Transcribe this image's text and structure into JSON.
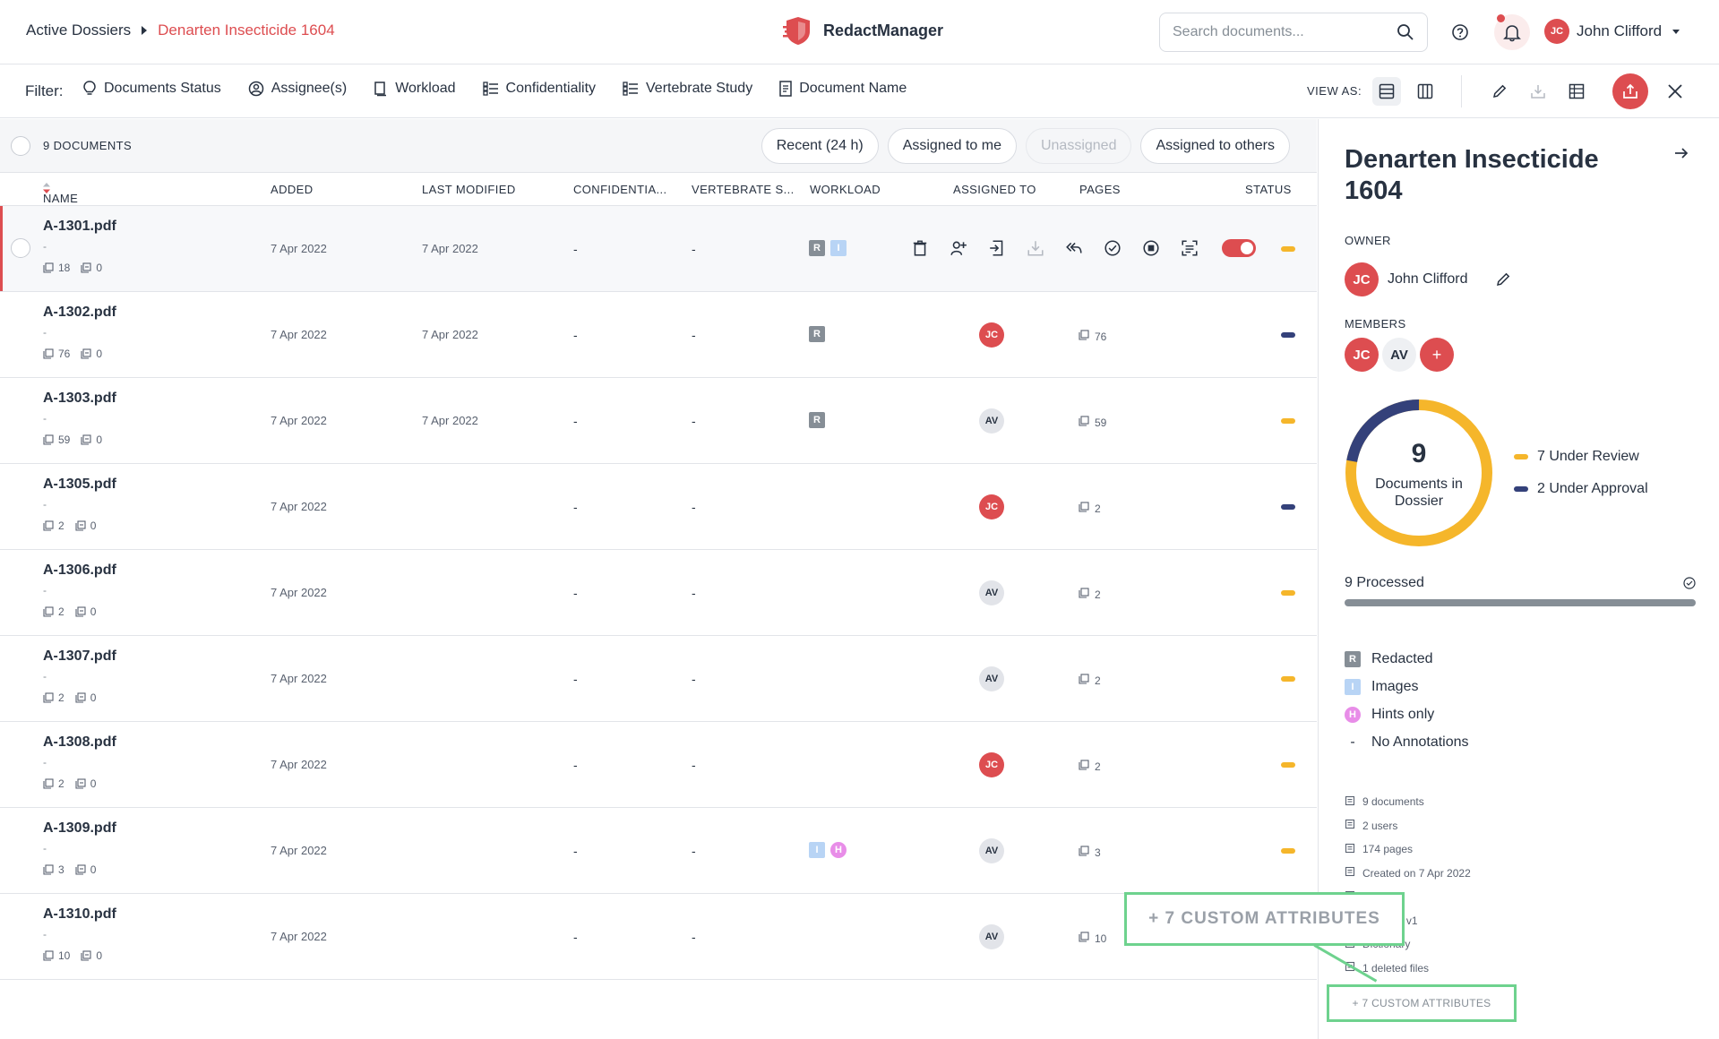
{
  "breadcrumb": {
    "root": "Active Dossiers",
    "current": "Denarten Insecticide 1604"
  },
  "app": {
    "name": "RedactManager"
  },
  "search": {
    "placeholder": "Search documents..."
  },
  "user": {
    "initials": "JC",
    "name": "John Clifford"
  },
  "filterbar": {
    "label": "Filter:",
    "filters": [
      "Documents Status",
      "Assignee(s)",
      "Workload",
      "Confidentiality",
      "Vertebrate Study",
      "Document Name"
    ],
    "view_as": "VIEW AS:"
  },
  "list": {
    "count": "9 DOCUMENTS",
    "quick_filters": [
      "Recent (24 h)",
      "Assigned to me",
      "Unassigned",
      "Assigned to others"
    ],
    "columns": [
      "NAME",
      "ADDED",
      "LAST MODIFIED",
      "CONFIDENTIA...",
      "VERTEBRATE S...",
      "WORKLOAD",
      "ASSIGNED TO",
      "PAGES",
      "STATUS"
    ],
    "rows": [
      {
        "name": "A-1301.pdf",
        "sub": "-",
        "pages_meta": "18",
        "files_meta": "0",
        "added": "7 Apr 2022",
        "modified": "7 Apr 2022",
        "conf": "-",
        "vert": "-",
        "workload": [
          "R",
          "I"
        ],
        "assignee": "",
        "pages": "",
        "status": "#f5b62b",
        "active": true
      },
      {
        "name": "A-1302.pdf",
        "sub": "-",
        "pages_meta": "76",
        "files_meta": "0",
        "added": "7 Apr 2022",
        "modified": "7 Apr 2022",
        "conf": "-",
        "vert": "-",
        "workload": [
          "R"
        ],
        "assignee": "JC",
        "pages": "76",
        "status": "#34417a"
      },
      {
        "name": "A-1303.pdf",
        "sub": "-",
        "pages_meta": "59",
        "files_meta": "0",
        "added": "7 Apr 2022",
        "modified": "7 Apr 2022",
        "conf": "-",
        "vert": "-",
        "workload": [
          "R"
        ],
        "assignee": "AV",
        "pages": "59",
        "status": "#f5b62b"
      },
      {
        "name": "A-1305.pdf",
        "sub": "-",
        "pages_meta": "2",
        "files_meta": "0",
        "added": "7 Apr 2022",
        "modified": "",
        "conf": "-",
        "vert": "-",
        "workload": [],
        "assignee": "JC",
        "pages": "2",
        "status": "#34417a"
      },
      {
        "name": "A-1306.pdf",
        "sub": "-",
        "pages_meta": "2",
        "files_meta": "0",
        "added": "7 Apr 2022",
        "modified": "",
        "conf": "-",
        "vert": "-",
        "workload": [],
        "assignee": "AV",
        "pages": "2",
        "status": "#f5b62b"
      },
      {
        "name": "A-1307.pdf",
        "sub": "-",
        "pages_meta": "2",
        "files_meta": "0",
        "added": "7 Apr 2022",
        "modified": "",
        "conf": "-",
        "vert": "-",
        "workload": [],
        "assignee": "AV",
        "pages": "2",
        "status": "#f5b62b"
      },
      {
        "name": "A-1308.pdf",
        "sub": "-",
        "pages_meta": "2",
        "files_meta": "0",
        "added": "7 Apr 2022",
        "modified": "",
        "conf": "-",
        "vert": "-",
        "workload": [],
        "assignee": "JC",
        "pages": "2",
        "status": "#f5b62b"
      },
      {
        "name": "A-1309.pdf",
        "sub": "-",
        "pages_meta": "3",
        "files_meta": "0",
        "added": "7 Apr 2022",
        "modified": "",
        "conf": "-",
        "vert": "-",
        "workload": [
          "I",
          "H"
        ],
        "assignee": "AV",
        "pages": "3",
        "status": "#f5b62b"
      },
      {
        "name": "A-1310.pdf",
        "sub": "-",
        "pages_meta": "10",
        "files_meta": "0",
        "added": "7 Apr 2022",
        "modified": "",
        "conf": "-",
        "vert": "-",
        "workload": [],
        "assignee": "AV",
        "pages": "10",
        "status": ""
      }
    ]
  },
  "panel": {
    "title": "Denarten Insecticide 1604",
    "owner_label": "OWNER",
    "owner": {
      "initials": "JC",
      "name": "John Clifford"
    },
    "members_label": "MEMBERS",
    "members": [
      "JC",
      "AV"
    ],
    "add_member": "+",
    "donut": {
      "total": "9",
      "caption": "Documents in Dossier",
      "under_review": 7,
      "under_approval": 2
    },
    "legend": [
      "7 Under Review",
      "2 Under Approval"
    ],
    "processed": "9 Processed",
    "processed_fraction": 1,
    "workload_legend": [
      {
        "badge": "R",
        "label": "Redacted"
      },
      {
        "badge": "I",
        "label": "Images"
      },
      {
        "badge": "H",
        "label": "Hints only"
      },
      {
        "badge": "-",
        "label": "No Annotations"
      }
    ],
    "stats": [
      "9 documents",
      "2 users",
      "174 pages",
      "Created on 7 Apr 2022",
      "pr 2022",
      "tion GFL v1",
      "Dictionary",
      "1 deleted files"
    ],
    "custom_attrs": "+ 7 CUSTOM ATTRIBUTES"
  },
  "callout": {
    "text": "+ 7 CUSTOM ATTRIBUTES"
  },
  "colors": {
    "accent": "#dd4d50",
    "review": "#f5b62b",
    "approval": "#34417a",
    "highlight": "#6ed28e"
  }
}
